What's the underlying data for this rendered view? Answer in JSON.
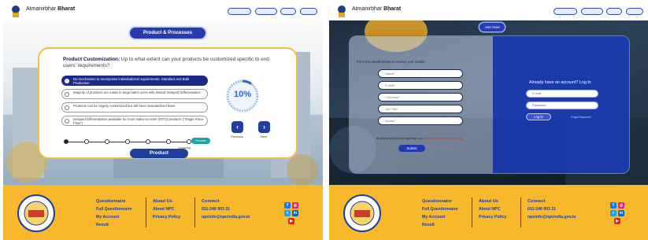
{
  "brand": {
    "prefix": "Atmanirbhar ",
    "name": "Bharat"
  },
  "header_buttons": [
    "",
    "",
    "",
    ""
  ],
  "left_page": {
    "section_title": "Product & Processes",
    "question_label": "Product Customization:",
    "question_text": " Up to what extent can your products be customized specific to end users' requirements?",
    "options": [
      {
        "text": "No mechanism to incorporate individualized requirements. Standard and Bulk Production",
        "selected": true
      },
      {
        "text": "Majority of products are made in large batch sizes with limited Delayed Differentiation",
        "selected": false
      },
      {
        "text": "Products can be largely customized but still have standardized base",
        "selected": false
      },
      {
        "text": "Delayed Differentiation available for most make-to-order (MTO) products (\"Single Piece Flow\")",
        "selected": false
      }
    ],
    "progress": {
      "percent_text": "10%",
      "value": 0.1
    },
    "nav": {
      "previous": "Previous",
      "next": "Next"
    },
    "stepper": {
      "current_badge": "Process",
      "upcoming_label": "Upcoming",
      "steps_total": 7,
      "steps_done": 1
    },
    "product_button": "Product"
  },
  "right_page": {
    "join_button": "Join Now",
    "form_hint": "Fill in the details below to receive your results",
    "fields": [
      "Name*",
      "E-mail*",
      "Company*",
      "Job Title*",
      "Sector*"
    ],
    "consent_text": "By clicking submit you are agreeing to our ",
    "consent_link": "Terms & Conditions, Privacy policy",
    "submit": "Submit",
    "login_heading": "Already have an account? Log in",
    "login_fields": [
      "E-mail",
      "Password"
    ],
    "login_button": "Log In",
    "forgot": "Forgot Password?"
  },
  "footer": {
    "questionnaire": {
      "heading": "Questionnaire",
      "items": [
        "Full Questionnaire",
        "My Account",
        "Result"
      ]
    },
    "about": {
      "heading": "About Us",
      "items": [
        "About NPC",
        "Privacy Policy"
      ]
    },
    "connect": {
      "heading": "Connect",
      "items": [
        "011-246 903 31",
        "npcinfo@npcindia.gov.in"
      ]
    },
    "seal_caption": "National Productivity Council",
    "social_icons": [
      "facebook-icon",
      "instagram-icon",
      "twitter-icon",
      "linkedin-icon",
      "youtube-icon"
    ]
  },
  "colors": {
    "primary": "#1e3f9e",
    "accent": "#f7b92b",
    "selected": "#1a2a85"
  }
}
